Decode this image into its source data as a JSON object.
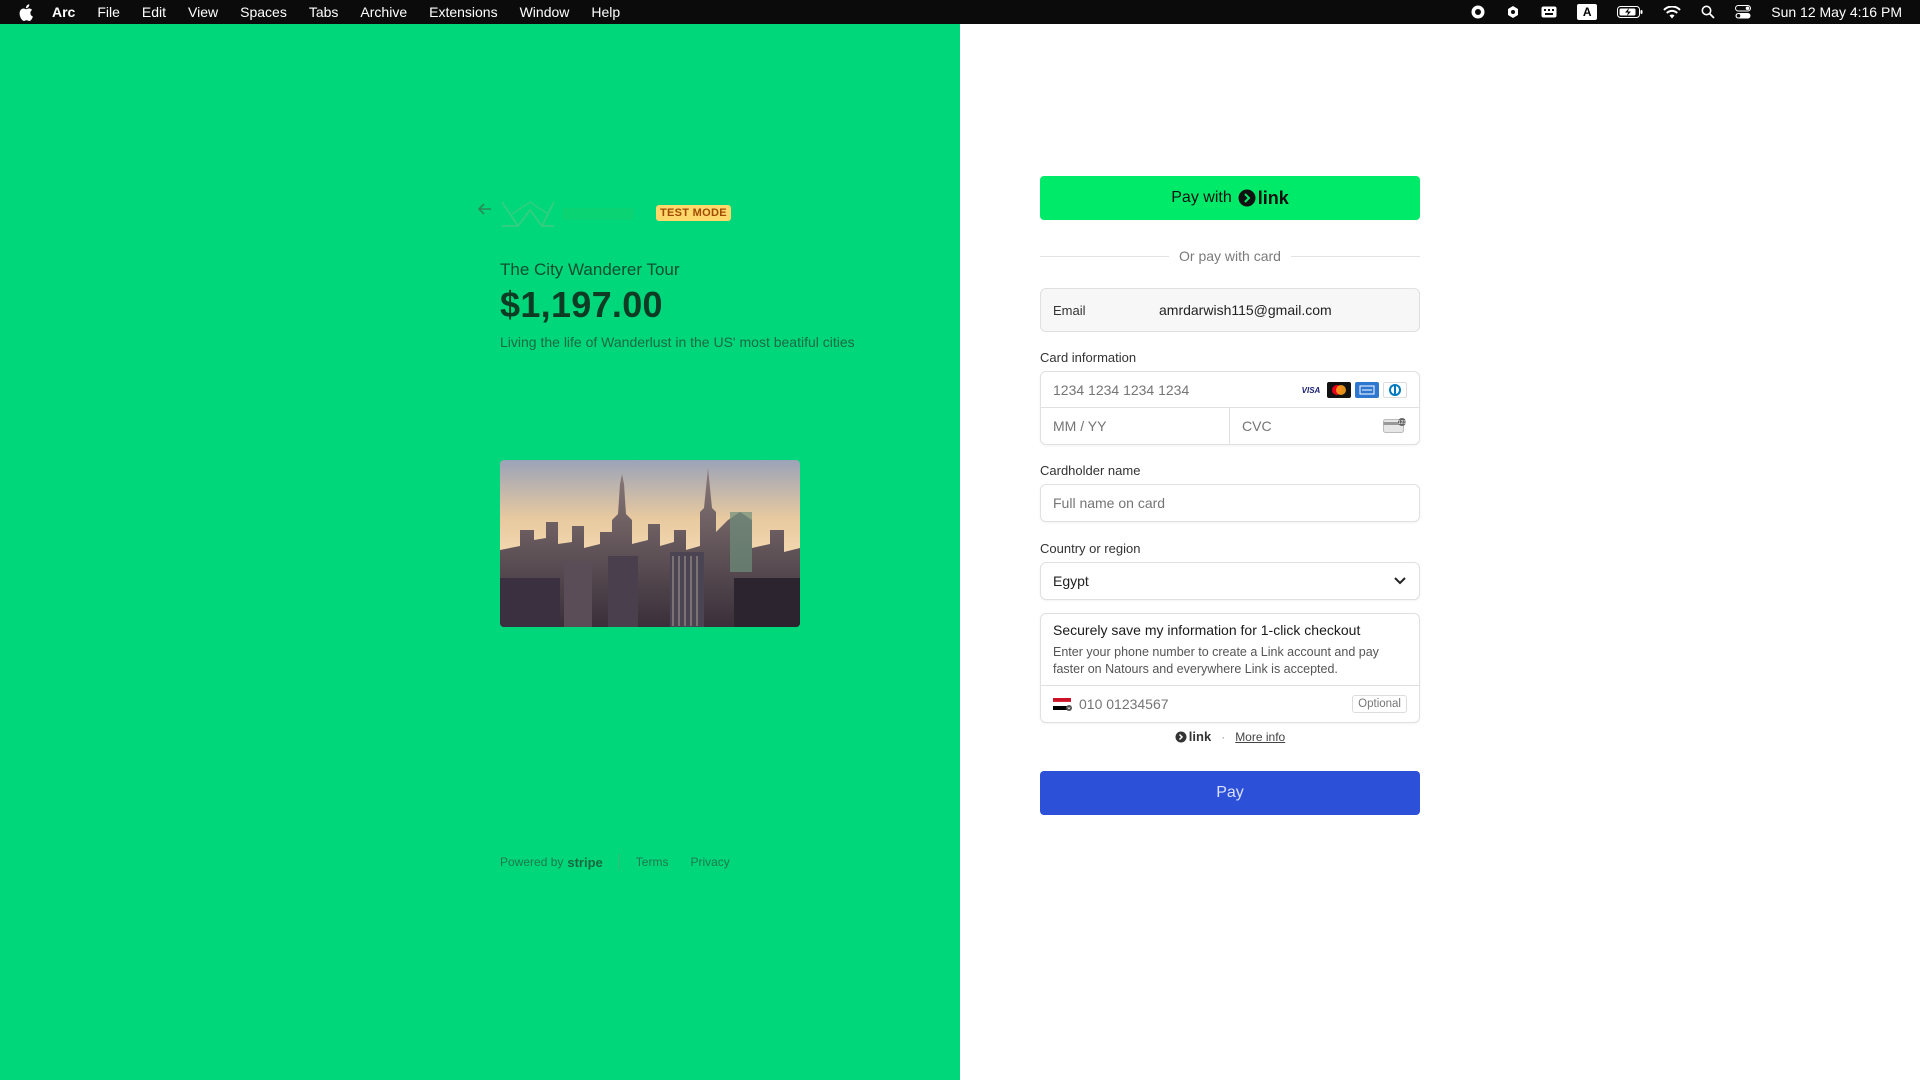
{
  "menubar": {
    "app_name": "Arc",
    "menus": [
      "File",
      "Edit",
      "View",
      "Spaces",
      "Tabs",
      "Archive",
      "Extensions",
      "Window",
      "Help"
    ],
    "status_icons": [
      "record-icon",
      "extension-icon",
      "keyboard-icon",
      "input-source-icon",
      "battery-icon",
      "wifi-icon",
      "search-icon",
      "control-center-icon"
    ],
    "input_source_letter": "A",
    "clock": "Sun 12 May  4:16 PM"
  },
  "left": {
    "background": "#00d67a",
    "test_mode": "TEST MODE",
    "product_name": "The City Wanderer Tour",
    "price": "$1,197.00",
    "description": "Living the life of Wanderlust in the US' most beatiful cities",
    "footer": {
      "powered_by": "Powered by",
      "stripe": "stripe",
      "terms": "Terms",
      "privacy": "Privacy"
    }
  },
  "form": {
    "link_button": {
      "prefix": "Pay with",
      "brand": "link"
    },
    "divider_text": "Or pay with card",
    "email": {
      "label": "Email",
      "value": "amrdarwish115@gmail.com"
    },
    "card": {
      "label": "Card information",
      "number_placeholder": "1234 1234 1234 1234",
      "expiry_placeholder": "MM / YY",
      "cvc_placeholder": "CVC",
      "brands": [
        "VISA",
        "mastercard",
        "amex",
        "diners"
      ]
    },
    "cardholder": {
      "label": "Cardholder name",
      "placeholder": "Full name on card"
    },
    "country": {
      "label": "Country or region",
      "value": "Egypt"
    },
    "save": {
      "title": "Securely save my information for 1-click checkout",
      "description": "Enter your phone number to create a Link account and pay faster on Natours and everywhere Link is accepted.",
      "phone_placeholder": "010 01234567",
      "optional": "Optional"
    },
    "link_footer": {
      "brand": "link",
      "more_info": "More info"
    },
    "pay_button": "Pay",
    "pay_color": "#2d50d8",
    "link_color": "#00ea6a"
  }
}
